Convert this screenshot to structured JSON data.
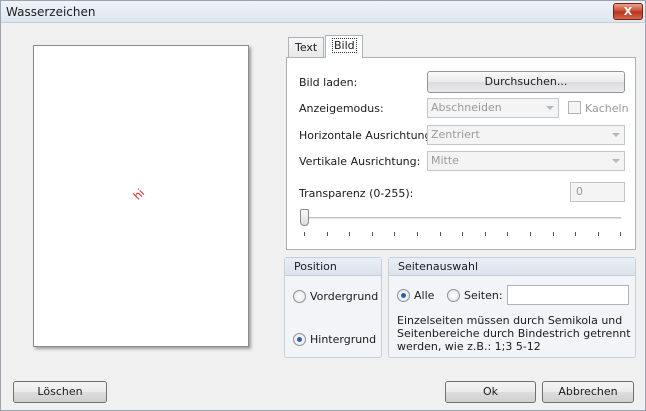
{
  "window": {
    "title": "Wasserzeichen",
    "close_glyph": "X"
  },
  "preview": {
    "watermark_text": "hi",
    "watermark_color": "#e11b1b"
  },
  "tabs": [
    {
      "label": "Text",
      "selected": false
    },
    {
      "label": "Bild",
      "selected": true
    }
  ],
  "image_tab": {
    "load_label": "Bild laden:",
    "browse_label": "Durchsuchen...",
    "display_mode_label": "Anzeigemodus:",
    "display_mode_value": "Abschneiden",
    "tile_label": "Kacheln",
    "tile_checked": false,
    "halign_label": "Horizontale Ausrichtung:",
    "halign_value": "Zentriert",
    "valign_label": "Vertikale Ausrichtung:",
    "valign_value": "Mitte",
    "transparency_label": "Transparenz (0-255):",
    "transparency_value": "0"
  },
  "position": {
    "title": "Position",
    "foreground_label": "Vordergrund",
    "background_label": "Hintergrund",
    "selected": "background"
  },
  "page_selection": {
    "title": "Seitenauswahl",
    "all_label": "Alle",
    "pages_label": "Seiten:",
    "pages_value": "",
    "selected": "all",
    "hint": "Einzelseiten müssen durch Semikola und Seitenbereiche durch Bindestrich getrennt werden, wie z.B.: 1;3 5-12"
  },
  "buttons": {
    "delete": "Löschen",
    "ok": "Ok",
    "cancel": "Abbrechen"
  }
}
